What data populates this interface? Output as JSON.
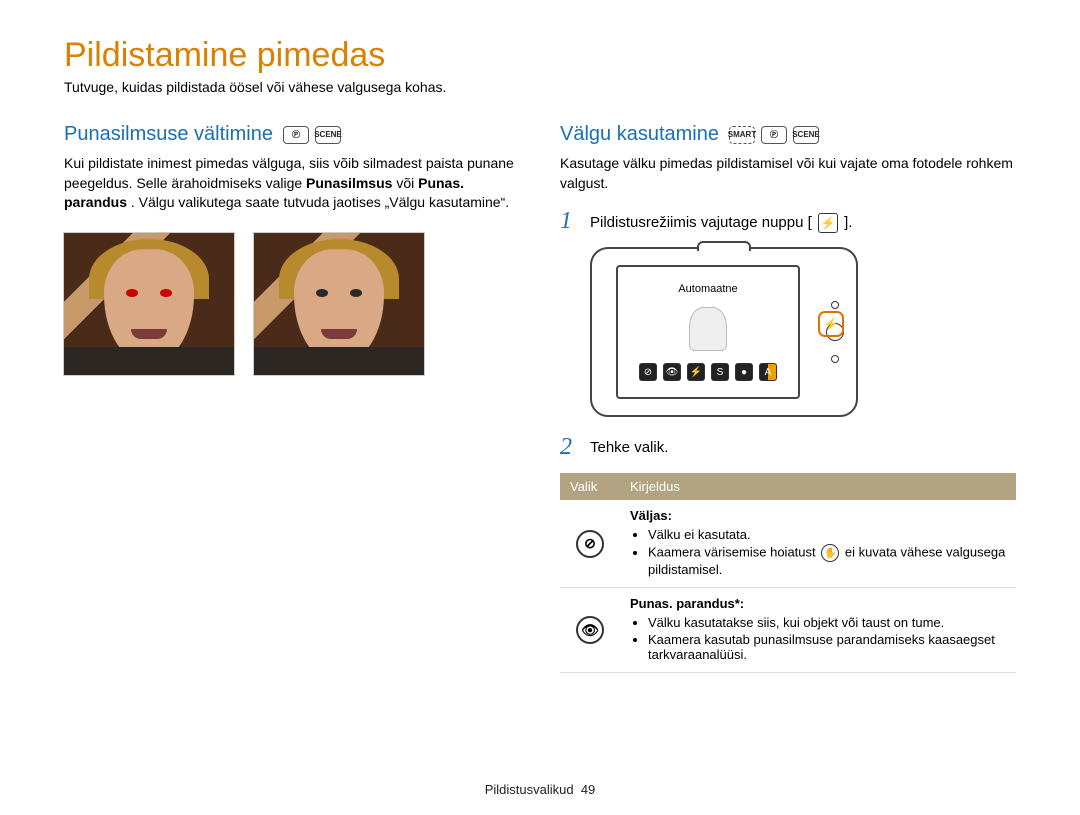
{
  "page": {
    "title": "Pildistamine pimedas",
    "intro": "Tutvuge, kuidas pildistada öösel või vähese valgusega kohas.",
    "footer_label": "Pildistusvalikud",
    "footer_page": "49"
  },
  "left": {
    "heading": "Punasilmsuse vältimine",
    "body_parts": {
      "a": "Kui pildistate inimest pimedas välguga, siis võib silmadest paista punane peegeldus. Selle ärahoidmiseks valige ",
      "b": "Punasilmsus",
      "c": " või ",
      "d": "Punas. parandus",
      "e": ". Välgu valikutega saate tutvuda jaotises „Välgu kasutamine“."
    }
  },
  "right": {
    "heading": "Välgu kasutamine",
    "body": "Kasutage välku pimedas pildistamisel või kui vajate oma fotodele rohkem valgust.",
    "steps": {
      "s1": "Pildistusrežiimis vajutage nuppu [",
      "s1_end": "].",
      "s2": "Tehke valik."
    },
    "camera_label": "Automaatne",
    "table": {
      "head_option": "Valik",
      "head_desc": "Kirjeldus",
      "rows": {
        "off": {
          "title": "Väljas:",
          "b1": "Välku ei kasutata.",
          "b2a": "Kaamera värisemise hoiatust ",
          "b2b": " ei kuvata vähese valgusega pildistamisel."
        },
        "fix": {
          "title": "Punas. parandus*:",
          "b1": "Välku kasutatakse siis, kui objekt või taust on tume.",
          "b2": "Kaamera kasutab punasilmsuse parandamiseks kaasaegset tarkvaraanalüüsi."
        }
      }
    }
  }
}
